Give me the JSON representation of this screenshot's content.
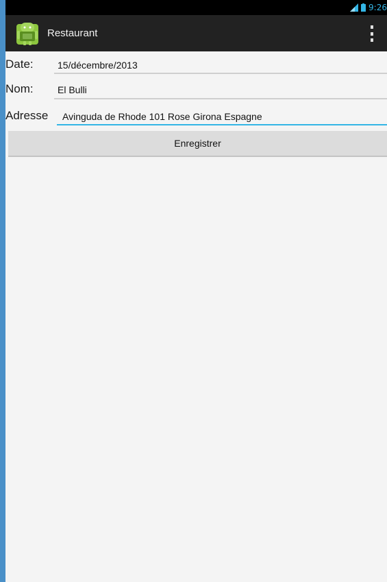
{
  "status_bar": {
    "time": "9:26",
    "signal_icon": "signal-icon",
    "battery_icon": "battery-icon",
    "accent": "#33b5e5"
  },
  "action_bar": {
    "app_icon": "android-app-icon",
    "title": "Restaurant",
    "menu_icon": "overflow-menu-icon"
  },
  "form": {
    "date": {
      "label": "Date:",
      "value": "15/décembre/2013"
    },
    "nom": {
      "label": "Nom:",
      "value": "El Bulli"
    },
    "adresse": {
      "label": "Adresse",
      "value": "Avinguda de Rhode 101 Rose Girona Espagne",
      "focused": true
    }
  },
  "save_button": {
    "label": "Enregistrer"
  }
}
